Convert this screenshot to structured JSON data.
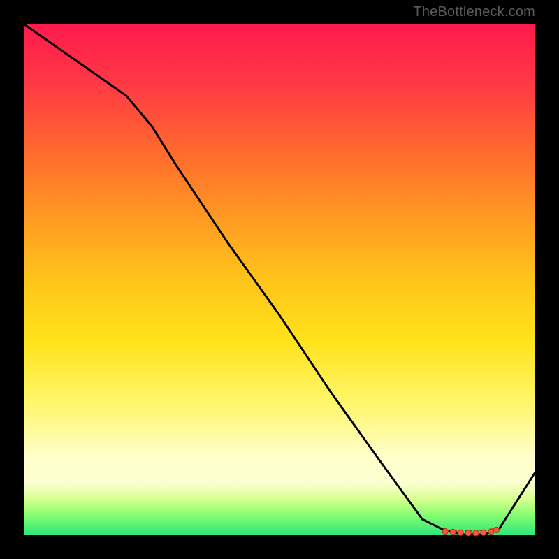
{
  "attribution": "TheBottleneck.com",
  "colors": {
    "page_bg": "#000000",
    "gradient_top": "#ff1a4d",
    "gradient_bottom": "#2fe87a",
    "line_color": "#000000",
    "marker_stroke": "#b6371a",
    "marker_fill": "#ff5a3c",
    "attribution_text": "#5a5a5a"
  },
  "chart_data": {
    "type": "line",
    "title": "",
    "xlabel": "",
    "ylabel": "",
    "xlim": [
      0,
      100
    ],
    "ylim": [
      0,
      100
    ],
    "grid": false,
    "legend": false,
    "series": [
      {
        "name": "curve",
        "x": [
          0,
          10,
          20,
          25,
          30,
          40,
          50,
          60,
          70,
          78,
          82,
          86,
          90,
          93,
          100
        ],
        "y": [
          100,
          93,
          86,
          80,
          72,
          57,
          43,
          28,
          14,
          3,
          1,
          0,
          0,
          1,
          12
        ]
      }
    ],
    "markers": {
      "name": "flat-region",
      "x": [
        82.5,
        84,
        85.5,
        87,
        88.5,
        90,
        91.5,
        92.5
      ],
      "y": [
        0.6,
        0.5,
        0.4,
        0.3,
        0.3,
        0.4,
        0.6,
        0.9
      ]
    }
  }
}
